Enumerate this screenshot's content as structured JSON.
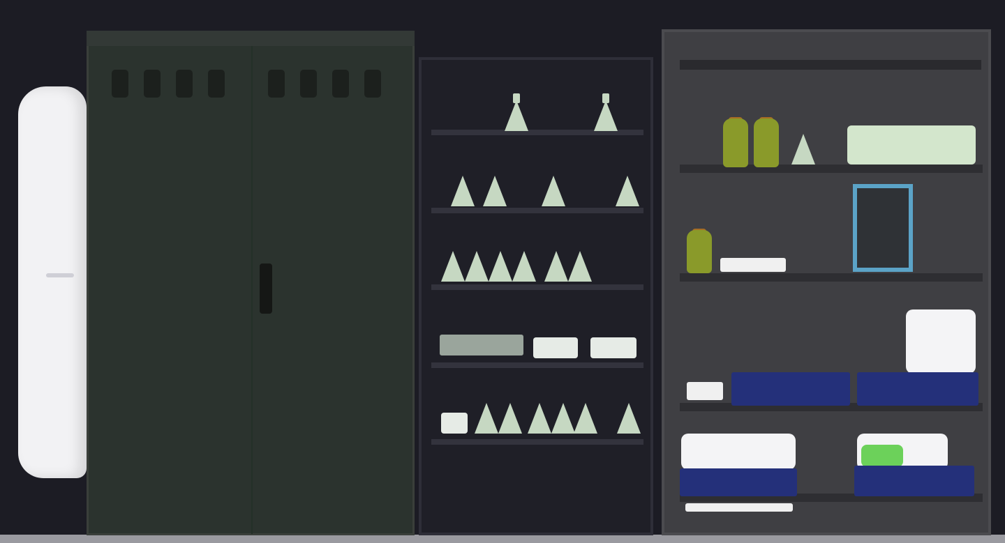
{
  "scene": {
    "name": "lab-room",
    "objects": {
      "door": "door",
      "cabinet": "green-metal-cabinet",
      "shelf": "glassware-shelf",
      "bench": "lab-bench"
    }
  },
  "colors": {
    "background": "#1c1c24",
    "cabinet_green": "#2b332e",
    "shelf_dark": "#1f1f27",
    "bench_gray": "#3f3f43",
    "glass": "#c6d8c2",
    "bottle_olive": "#8a9a2a",
    "accent_blue": "#24307a",
    "accent_cyan": "#5ba3c7",
    "accent_green": "#6cd15a"
  }
}
